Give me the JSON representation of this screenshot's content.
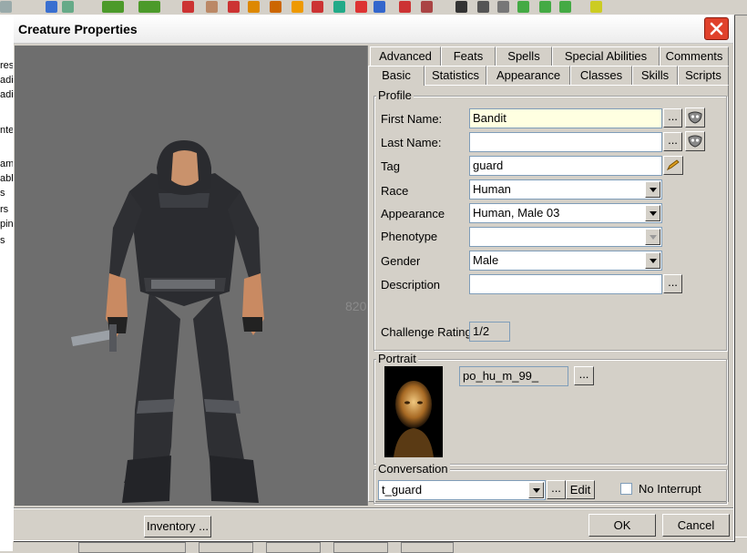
{
  "dialog": {
    "title": "Creature Properties",
    "viewport_watermark": "820"
  },
  "tabs_row1": [
    "Advanced",
    "Feats",
    "Spells",
    "Special Abilities",
    "Comments"
  ],
  "tabs_row2": [
    "Basic",
    "Statistics",
    "Appearance",
    "Classes",
    "Skills",
    "Scripts"
  ],
  "active_tab": "Basic",
  "profile": {
    "group_label": "Profile",
    "first_name_label": "First Name:",
    "first_name_value": "Bandit",
    "last_name_label": "Last Name:",
    "last_name_value": "",
    "tag_label": "Tag",
    "tag_value": "guard",
    "race_label": "Race",
    "race_value": "Human",
    "appearance_label": "Appearance",
    "appearance_value": "Human, Male 03",
    "phenotype_label": "Phenotype",
    "phenotype_value": "",
    "gender_label": "Gender",
    "gender_value": "Male",
    "description_label": "Description",
    "description_value": "",
    "challenge_label": "Challenge Rating",
    "challenge_value": "1/2",
    "ellipsis": "..."
  },
  "portrait": {
    "group_label": "Portrait",
    "value": "po_hu_m_99_",
    "ellipsis": "..."
  },
  "conversation": {
    "group_label": "Conversation",
    "value": "t_guard",
    "ellipsis": "...",
    "edit_label": "Edit",
    "no_interrupt_label": "No Interrupt",
    "no_interrupt_checked": false
  },
  "footer": {
    "inventory_label": "Inventory ...",
    "ok_label": "OK",
    "cancel_label": "Cancel"
  },
  "background": {
    "left_fragments": [
      "res",
      "adi",
      "adi",
      "nte",
      "am",
      "abl",
      "s",
      "rs",
      "pin",
      "s"
    ]
  },
  "colors": {
    "close_button": "#e0412b",
    "first_name_bg": "#ffffe1",
    "viewport_bg": "#6e6e6e"
  }
}
